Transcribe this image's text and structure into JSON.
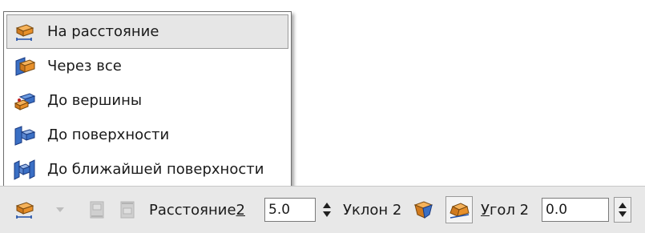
{
  "menu": {
    "items": [
      {
        "label": "На расстояние",
        "icon": "extrude-distance-icon",
        "selected": true
      },
      {
        "label": "Через все",
        "icon": "extrude-through-all-icon",
        "selected": false
      },
      {
        "label": "До вершины",
        "icon": "extrude-to-vertex-icon",
        "selected": false
      },
      {
        "label": "До поверхности",
        "icon": "extrude-to-surface-icon",
        "selected": false
      },
      {
        "label": "До ближайшей поверхности",
        "icon": "extrude-to-nearest-surface-icon",
        "selected": false
      }
    ]
  },
  "toolbar": {
    "distance_label": "Расстояние ",
    "distance_label_hotkey": "2",
    "distance_value": "5.0",
    "slope_label": "Уклон 2",
    "angle_label_hotkey": "У",
    "angle_label_rest": "гол 2",
    "angle_value": "0.0",
    "icons": {
      "method": "extrude-distance-icon",
      "dropdown": "dropdown-arrow-icon",
      "direction_1": "direction-forward-icon",
      "direction_2": "direction-reverse-icon",
      "slope_in": "slope-inward-icon",
      "slope_out": "slope-outward-icon"
    }
  },
  "colors": {
    "menu_selected_bg": "#e6e6e6",
    "toolbar_bg": "#e8e8e8",
    "icon_orange": "#e8902a",
    "icon_blue": "#3a6fc4"
  }
}
